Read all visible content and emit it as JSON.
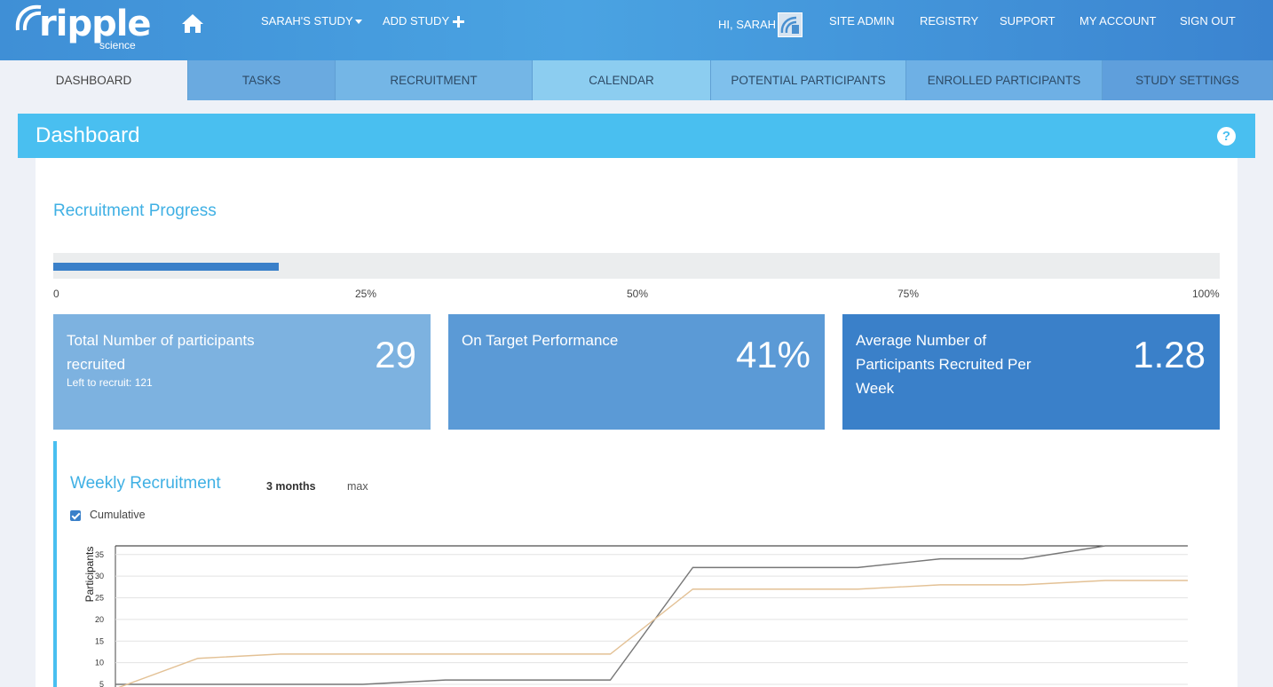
{
  "brand": {
    "name": "ripple",
    "sub": "science"
  },
  "topnav": {
    "study_label": "SARAH'S STUDY",
    "add_study_label": "ADD STUDY",
    "greeting": "HI, SARAH",
    "items": [
      "SITE ADMIN",
      "REGISTRY",
      "SUPPORT",
      "MY ACCOUNT",
      "SIGN OUT"
    ]
  },
  "tabs": [
    "DASHBOARD",
    "TASKS",
    "RECRUITMENT",
    "CALENDAR",
    "POTENTIAL PARTICIPANTS",
    "ENROLLED PARTICIPANTS",
    "STUDY SETTINGS"
  ],
  "page": {
    "title": "Dashboard",
    "help": "?"
  },
  "recruitment_progress": {
    "title": "Recruitment Progress",
    "progress_fraction": 0.193,
    "ticks": [
      "0",
      "25%",
      "50%",
      "75%",
      "100%"
    ]
  },
  "stats": [
    {
      "label": "Total Number of participants recruited",
      "sublabel": "Left to recruit: 121",
      "value": "29",
      "color": "#7db2e0"
    },
    {
      "label": "On Target Performance",
      "sublabel": "",
      "value": "41%",
      "color": "#5b9ad6"
    },
    {
      "label": "Average Number of Participants Recruited Per Week",
      "sublabel": "",
      "value": "1.28",
      "color": "#3a80c9"
    }
  ],
  "weekly": {
    "title": "Weekly Recruitment",
    "range_options": [
      "3 months",
      "max"
    ],
    "selected_range": "3 months",
    "cumulative_label": "Cumulative",
    "cumulative_checked": true
  },
  "chart_data": {
    "type": "line",
    "ylabel": "Participants",
    "xlabel": "",
    "ylim": [
      5,
      37
    ],
    "yticks": [
      5,
      10,
      15,
      20,
      25,
      30,
      35
    ],
    "grid": true,
    "x": [
      0,
      1,
      2,
      3,
      4,
      5,
      6,
      7,
      8,
      9,
      10,
      11,
      12,
      13
    ],
    "series": [
      {
        "values": [
          5,
          5,
          5,
          5,
          6,
          6,
          6,
          32,
          32,
          32,
          34,
          34,
          37,
          37
        ],
        "color": "#777777"
      },
      {
        "values": [
          4,
          11,
          12,
          12,
          12,
          12,
          12,
          27,
          27,
          27,
          28,
          28,
          29,
          29
        ],
        "color": "#e3c195"
      }
    ]
  }
}
